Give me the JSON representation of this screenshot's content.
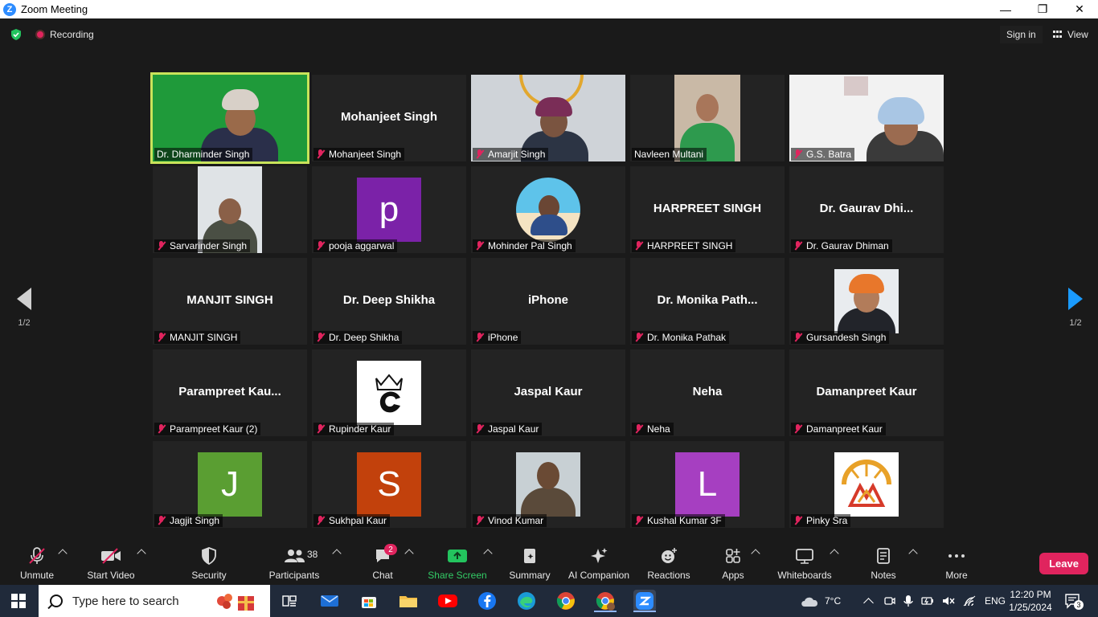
{
  "window": {
    "title": "Zoom Meeting",
    "app_icon": "Z",
    "minimize": "—",
    "maximize": "❐",
    "close": "✕"
  },
  "topbar": {
    "recording_label": "Recording",
    "signin_label": "Sign in",
    "view_label": "View"
  },
  "gallery": {
    "page_prev": "1/2",
    "page_next": "1/2",
    "tiles": [
      {
        "label": "Dr. Dharminder Singh",
        "big": "",
        "kind": "video",
        "muted": false,
        "active": true
      },
      {
        "label": "Mohanjeet Singh",
        "big": "Mohanjeet Singh",
        "kind": "name",
        "muted": true
      },
      {
        "label": "Amarjit Singh",
        "big": "",
        "kind": "video",
        "muted": true
      },
      {
        "label": "Navleen Multani",
        "big": "",
        "kind": "video",
        "muted": false
      },
      {
        "label": "G.S. Batra",
        "big": "",
        "kind": "video",
        "muted": true
      },
      {
        "label": "Sarvarinder Singh",
        "big": "",
        "kind": "photo",
        "muted": true
      },
      {
        "label": "pooja aggarwal",
        "big": "",
        "kind": "avatar",
        "letter": "p",
        "color": "#7b22a8",
        "muted": true
      },
      {
        "label": "Mohinder Pal Singh",
        "big": "",
        "kind": "photo",
        "muted": true
      },
      {
        "label": "HARPREET SINGH",
        "big": "HARPREET SINGH",
        "kind": "name",
        "muted": true
      },
      {
        "label": "Dr. Gaurav Dhiman",
        "big": "Dr. Gaurav  Dhi...",
        "kind": "name",
        "muted": true
      },
      {
        "label": "MANJIT SINGH",
        "big": "MANJIT SINGH",
        "kind": "name",
        "muted": true
      },
      {
        "label": "Dr. Deep Shikha",
        "big": "Dr. Deep Shikha",
        "kind": "name",
        "muted": true
      },
      {
        "label": "iPhone",
        "big": "iPhone",
        "kind": "name",
        "muted": true
      },
      {
        "label": "Dr. Monika Pathak",
        "big": "Dr.  Monika  Path...",
        "kind": "name",
        "muted": true
      },
      {
        "label": "Gursandesh Singh",
        "big": "",
        "kind": "photo",
        "muted": true
      },
      {
        "label": "Parampreet Kaur (2)",
        "big": "Parampreet  Kau...",
        "kind": "name",
        "muted": true
      },
      {
        "label": "Rupinder Kaur",
        "big": "",
        "kind": "logo",
        "muted": true
      },
      {
        "label": "Jaspal Kaur",
        "big": "Jaspal Kaur",
        "kind": "name",
        "muted": true
      },
      {
        "label": "Neha",
        "big": "Neha",
        "kind": "name",
        "muted": true
      },
      {
        "label": "Damanpreet Kaur",
        "big": "Damanpreet Kaur",
        "kind": "name",
        "muted": true
      },
      {
        "label": "Jagjit Singh",
        "big": "",
        "kind": "avatar",
        "letter": "J",
        "color": "#5a9e32",
        "muted": true
      },
      {
        "label": "Sukhpal Kaur",
        "big": "",
        "kind": "avatar",
        "letter": "S",
        "color": "#c2410c",
        "muted": true
      },
      {
        "label": "Vinod Kumar",
        "big": "",
        "kind": "photo",
        "muted": true
      },
      {
        "label": "Kushal Kumar 3F",
        "big": "",
        "kind": "avatar",
        "letter": "L",
        "color": "#a63fc1",
        "muted": true
      },
      {
        "label": "Pinky Sra",
        "big": "",
        "kind": "logo2",
        "muted": true
      }
    ]
  },
  "toolbar": {
    "unmute": "Unmute",
    "start_video": "Start Video",
    "security": "Security",
    "participants": "Participants",
    "participants_count": "38",
    "chat": "Chat",
    "chat_badge": "2",
    "share_screen": "Share Screen",
    "summary": "Summary",
    "ai_companion": "AI Companion",
    "reactions": "Reactions",
    "apps": "Apps",
    "whiteboards": "Whiteboards",
    "notes": "Notes",
    "more": "More",
    "leave": "Leave"
  },
  "taskbar": {
    "search_placeholder": "Type here to search",
    "weather": "7°C",
    "language": "ENG",
    "time": "12:20 PM",
    "date": "1/25/2024",
    "notifications": "3"
  },
  "colors": {
    "accent": "#2d8cff",
    "leave": "#e0245e",
    "active_border": "#c9e35a",
    "share_green": "#33cc66"
  }
}
